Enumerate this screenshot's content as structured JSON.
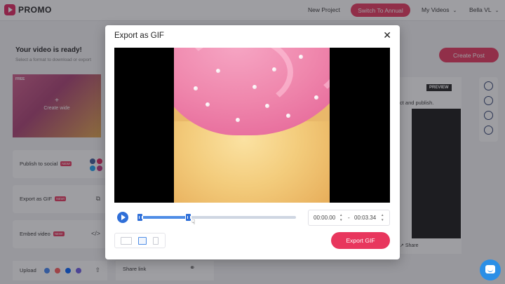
{
  "header": {
    "logo_text": "PROMO",
    "new_project": "New Project",
    "switch_annual": "Switch To Annual",
    "my_videos": "My Videos",
    "user": "Bella VL"
  },
  "left": {
    "title": "Your video is ready!",
    "subtitle": "Select a format to download or export",
    "thumb_badge": "FREE",
    "thumb_plus": "+",
    "thumb_create": "Create wide",
    "options": [
      {
        "label": "Publish to social",
        "badge": "NEW!"
      },
      {
        "label": "Export as GIF",
        "badge": "NEW!"
      },
      {
        "label": "Embed video",
        "badge": "NEW!"
      },
      {
        "label": "Upload",
        "badge": ""
      }
    ]
  },
  "right": {
    "create_post": "Create Post",
    "preview": "PREVIEW",
    "text": "ct and publish.",
    "share": "Share",
    "share_link": "Share link"
  },
  "modal": {
    "title": "Export as GIF",
    "start_time": "00:00.00",
    "end_time": "00:03.34",
    "separator": "-",
    "export_label": "Export GIF",
    "timeline_selected_fraction": 0.32
  },
  "colors": {
    "brand": "#e8365d",
    "accent": "#2f6fd8"
  }
}
